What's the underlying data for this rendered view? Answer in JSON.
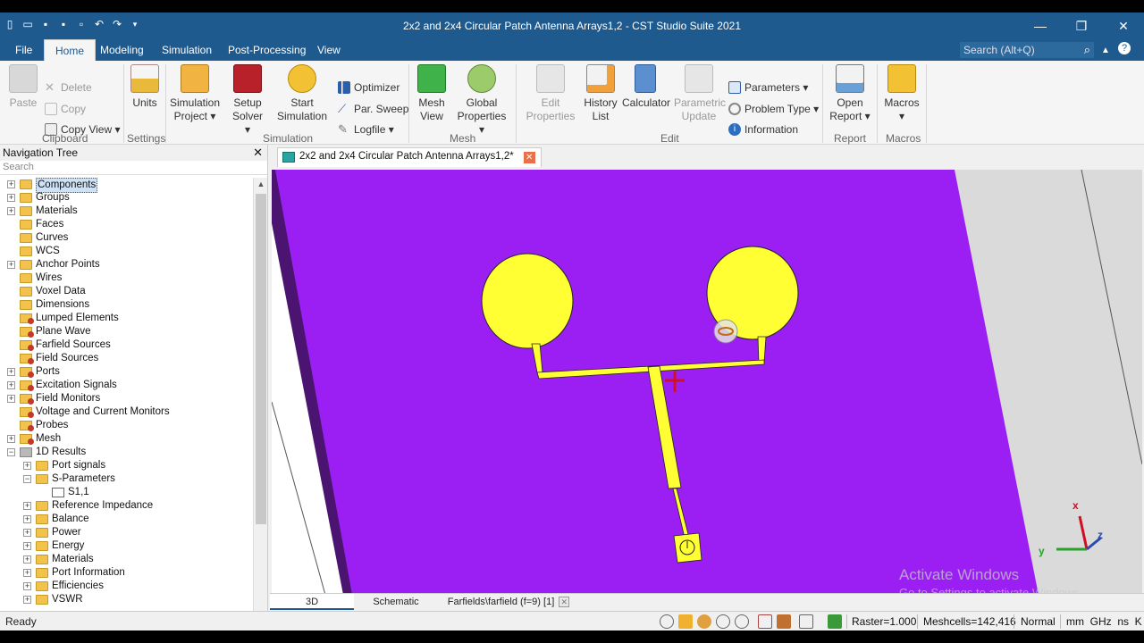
{
  "window": {
    "title": "2x2 and 2x4 Circular Patch Antenna Arrays1,2 - CST Studio Suite 2021"
  },
  "menubar": {
    "items": [
      "File",
      "Home",
      "Modeling",
      "Simulation",
      "Post-Processing",
      "View"
    ],
    "active": "Home",
    "search_placeholder": "Search (Alt+Q)"
  },
  "ribbon": {
    "clipboard": {
      "paste": "Paste",
      "delete": "Delete",
      "copy": "Copy",
      "copy_view": "Copy View",
      "label": "Clipboard"
    },
    "settings": {
      "units": "Units",
      "label": "Settings"
    },
    "simulation": {
      "simulation_project": "Simulation Project",
      "setup_solver": "Setup Solver",
      "start_simulation": "Start Simulation",
      "optimizer": "Optimizer",
      "par_sweep": "Par. Sweep",
      "logfile": "Logfile",
      "label": "Simulation"
    },
    "mesh": {
      "mesh_view": "Mesh View",
      "global_properties": "Global Properties",
      "label": "Mesh"
    },
    "edit": {
      "edit_properties": "Edit Properties",
      "history_list": "History List",
      "calculator": "Calculator",
      "parametric_update": "Parametric Update",
      "parameters": "Parameters",
      "problem_type": "Problem Type",
      "information": "Information",
      "label": "Edit"
    },
    "report": {
      "open_report": "Open Report",
      "label": "Report"
    },
    "macros": {
      "macros": "Macros",
      "label": "Macros"
    }
  },
  "navtree": {
    "title": "Navigation Tree",
    "search_placeholder": "Search",
    "nodes": [
      {
        "label": "Components",
        "indent": 0,
        "exp": "+",
        "icon": "folder",
        "selected": true
      },
      {
        "label": "Groups",
        "indent": 0,
        "exp": "+",
        "icon": "folder"
      },
      {
        "label": "Materials",
        "indent": 0,
        "exp": "+",
        "icon": "folder"
      },
      {
        "label": "Faces",
        "indent": 0,
        "exp": "",
        "icon": "folder"
      },
      {
        "label": "Curves",
        "indent": 0,
        "exp": "",
        "icon": "folder"
      },
      {
        "label": "WCS",
        "indent": 0,
        "exp": "",
        "icon": "folder"
      },
      {
        "label": "Anchor Points",
        "indent": 0,
        "exp": "+",
        "icon": "folder"
      },
      {
        "label": "Wires",
        "indent": 0,
        "exp": "",
        "icon": "folder"
      },
      {
        "label": "Voxel Data",
        "indent": 0,
        "exp": "",
        "icon": "folder"
      },
      {
        "label": "Dimensions",
        "indent": 0,
        "exp": "",
        "icon": "folder"
      },
      {
        "label": "Lumped Elements",
        "indent": 0,
        "exp": "",
        "icon": "folder-red"
      },
      {
        "label": "Plane Wave",
        "indent": 0,
        "exp": "",
        "icon": "folder-red"
      },
      {
        "label": "Farfield Sources",
        "indent": 0,
        "exp": "",
        "icon": "folder-red"
      },
      {
        "label": "Field Sources",
        "indent": 0,
        "exp": "",
        "icon": "folder-red"
      },
      {
        "label": "Ports",
        "indent": 0,
        "exp": "+",
        "icon": "folder-red"
      },
      {
        "label": "Excitation Signals",
        "indent": 0,
        "exp": "+",
        "icon": "folder-red"
      },
      {
        "label": "Field Monitors",
        "indent": 0,
        "exp": "+",
        "icon": "folder-red"
      },
      {
        "label": "Voltage and Current Monitors",
        "indent": 0,
        "exp": "",
        "icon": "folder-red"
      },
      {
        "label": "Probes",
        "indent": 0,
        "exp": "",
        "icon": "folder-red"
      },
      {
        "label": "Mesh",
        "indent": 0,
        "exp": "+",
        "icon": "folder-red"
      },
      {
        "label": "1D Results",
        "indent": 0,
        "exp": "-",
        "icon": "folder-gray"
      },
      {
        "label": "Port signals",
        "indent": 1,
        "exp": "+",
        "icon": "folder"
      },
      {
        "label": "S-Parameters",
        "indent": 1,
        "exp": "-",
        "icon": "folder"
      },
      {
        "label": "S1,1",
        "indent": 2,
        "exp": "",
        "icon": "result"
      },
      {
        "label": "Reference Impedance",
        "indent": 1,
        "exp": "+",
        "icon": "folder"
      },
      {
        "label": "Balance",
        "indent": 1,
        "exp": "+",
        "icon": "folder"
      },
      {
        "label": "Power",
        "indent": 1,
        "exp": "+",
        "icon": "folder"
      },
      {
        "label": "Energy",
        "indent": 1,
        "exp": "+",
        "icon": "folder"
      },
      {
        "label": "Materials",
        "indent": 1,
        "exp": "+",
        "icon": "folder"
      },
      {
        "label": "Port Information",
        "indent": 1,
        "exp": "+",
        "icon": "folder"
      },
      {
        "label": "Efficiencies",
        "indent": 1,
        "exp": "+",
        "icon": "folder"
      },
      {
        "label": "VSWR",
        "indent": 1,
        "exp": "+",
        "icon": "folder"
      }
    ]
  },
  "document": {
    "tab_title": "2x2 and 2x4 Circular Patch Antenna Arrays1,2*"
  },
  "viewtabs": [
    "3D",
    "Schematic",
    "Farfields\\farfield (f=9) [1]"
  ],
  "viewport": {
    "axis_x": "x",
    "axis_y": "y",
    "axis_z": "z",
    "watermark_title": "Activate Windows",
    "watermark_sub": "Go to Settings to activate Windows.",
    "colors": {
      "substrate": "#9b1ff2",
      "patch": "#ffff33",
      "background": "#ffffff"
    }
  },
  "status": {
    "ready": "Ready",
    "raster": "Raster=1.000",
    "meshcells": "Meshcells=142,416",
    "mode": "Normal",
    "units": "mm  GHz  ns  K"
  }
}
